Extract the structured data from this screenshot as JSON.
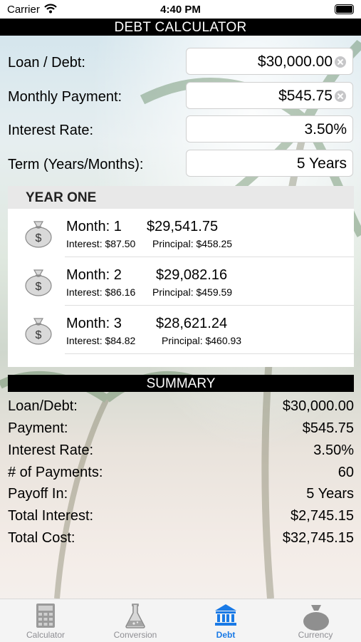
{
  "status": {
    "carrier": "Carrier",
    "time": "4:40 PM"
  },
  "title": "DEBT CALCULATOR",
  "form": {
    "loan": {
      "label": "Loan / Debt:",
      "value": "$30,000.00"
    },
    "payment": {
      "label": "Monthly Payment:",
      "value": "$545.75"
    },
    "rate": {
      "label": "Interest Rate:",
      "value": "3.50%"
    },
    "term": {
      "label": "Term (Years/Months):",
      "value": "5 Years"
    }
  },
  "schedule": {
    "header": "YEAR ONE",
    "rows": [
      {
        "month": "Month: 1",
        "balance": "$29,541.75",
        "interest": "Interest: $87.50",
        "principal": "Principal: $458.25"
      },
      {
        "month": "Month: 2",
        "balance": "$29,082.16",
        "interest": "Interest: $86.16",
        "principal": "Principal: $459.59"
      },
      {
        "month": "Month: 3",
        "balance": "$28,621.24",
        "interest": "Interest: $84.82",
        "principal": "Principal: $460.93"
      }
    ]
  },
  "summary": {
    "header": "SUMMARY",
    "rows": [
      {
        "label": "Loan/Debt:",
        "value": "$30,000.00"
      },
      {
        "label": "Payment:",
        "value": "$545.75"
      },
      {
        "label": "Interest Rate:",
        "value": "3.50%"
      },
      {
        "label": "# of Payments:",
        "value": "60"
      },
      {
        "label": "Payoff In:",
        "value": "5 Years"
      },
      {
        "label": "Total Interest:",
        "value": "$2,745.15"
      },
      {
        "label": "Total Cost:",
        "value": "$32,745.15"
      }
    ]
  },
  "tabs": [
    {
      "label": "Calculator",
      "icon": "calculator-icon"
    },
    {
      "label": "Conversion",
      "icon": "flask-icon"
    },
    {
      "label": "Debt",
      "icon": "bank-icon",
      "active": true
    },
    {
      "label": "Currency",
      "icon": "money-bag-icon"
    }
  ],
  "colors": {
    "accent": "#1a7ae6",
    "bar": "#000000",
    "inactive_tab": "#8e8e93"
  }
}
